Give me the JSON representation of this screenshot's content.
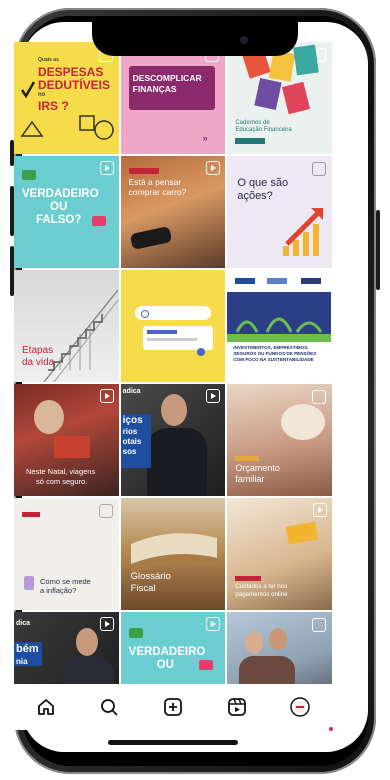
{
  "posts": [
    {
      "lines": [
        "Quais as",
        "DESPESAS",
        "DEDUTÍVEIS",
        "no",
        "IRS ?"
      ]
    },
    {
      "lines": [
        "DESCOMPLICAR",
        "FINANÇAS"
      ]
    },
    {
      "lines": [
        "Cadernos de",
        "Educação Financeira"
      ]
    },
    {
      "lines": [
        "VERDADEIRO",
        "OU",
        "FALSO?"
      ]
    },
    {
      "lines": [
        "Está a pensar",
        "comprar carro?"
      ]
    },
    {
      "lines": [
        "O que são",
        "ações?"
      ]
    },
    {
      "lines": [
        "Etapas",
        "da vida"
      ]
    },
    {
      "lines": []
    },
    {
      "lines": [
        "INVESTIMENTOS, EMPRÉSTIMOS,",
        "SEGUROS OU FUNDOS DE PENSÕES",
        "COM FOCO NA SUSTENTABILIDADE"
      ]
    },
    {
      "lines": [
        "Neste Natal, viagens",
        "só com seguro."
      ]
    },
    {
      "lines": [
        "adica",
        "iços",
        "rios",
        "otais",
        "sos"
      ]
    },
    {
      "lines": [
        "Orçamento",
        "familiar"
      ]
    },
    {
      "lines": [
        "Como se mede",
        "a inflação?"
      ]
    },
    {
      "lines": [
        "Glossário",
        "Fiscal"
      ]
    },
    {
      "lines": [
        "Cuidados a ter nos",
        "pagamentos online"
      ]
    },
    {
      "lines": [
        "dica",
        "bém",
        "nia"
      ]
    },
    {
      "lines": [
        "VERDADEIRO",
        "OU"
      ]
    },
    {
      "lines": []
    }
  ],
  "nav": [
    "home-icon",
    "search-icon",
    "create-icon",
    "reels-icon",
    "profile-icon"
  ],
  "colors": {
    "yellow": "#f6dc4b",
    "purple": "#7b2a6e",
    "teal": "#6ccdd0",
    "pink": "#e23f6a",
    "cream": "#f1efe9"
  }
}
